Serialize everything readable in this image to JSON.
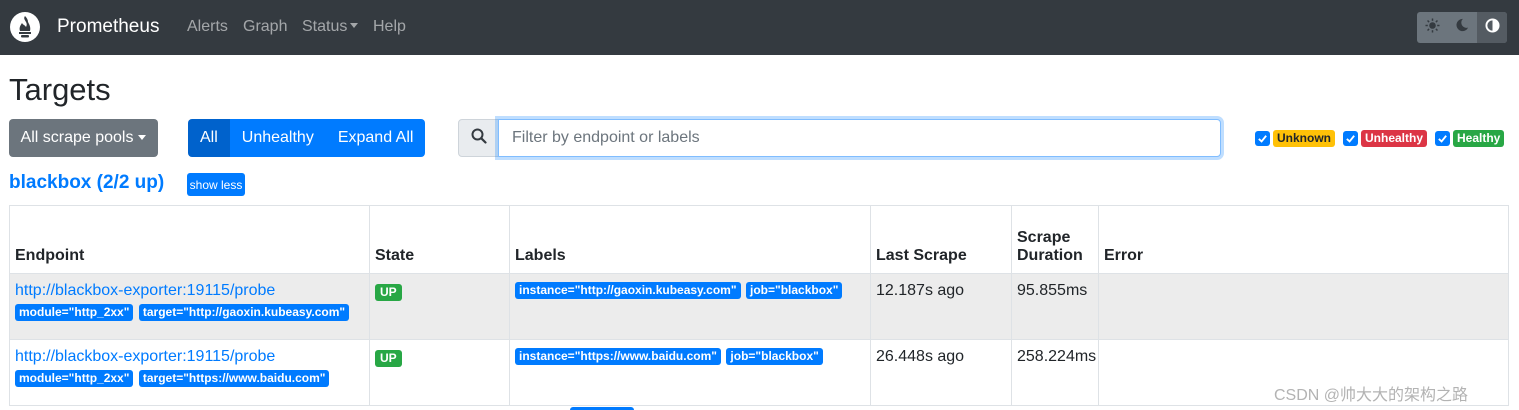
{
  "navbar": {
    "brand": "Prometheus",
    "links": [
      "Alerts",
      "Graph",
      "Status",
      "Help"
    ]
  },
  "page": {
    "title": "Targets"
  },
  "controls": {
    "scrape_pools_label": "All scrape pools",
    "filter_buttons": [
      "All",
      "Unhealthy",
      "Expand All"
    ],
    "search_placeholder": "Filter by endpoint or labels",
    "legend": [
      "Unknown",
      "Unhealthy",
      "Healthy"
    ]
  },
  "pool": {
    "title": "blackbox (2/2 up)",
    "toggle_label": "show less",
    "columns": [
      "Endpoint",
      "State",
      "Labels",
      "Last Scrape",
      "Scrape Duration",
      "Error"
    ],
    "rows": [
      {
        "endpoint": "http://blackbox-exporter:19115/probe",
        "endpoint_params": [
          "module=\"http_2xx\"",
          "target=\"http://gaoxin.kubeasy.com\""
        ],
        "state": "UP",
        "labels": [
          "instance=\"http://gaoxin.kubeasy.com\"",
          "job=\"blackbox\""
        ],
        "last_scrape": "12.187s ago",
        "scrape_duration": "95.855ms",
        "error": ""
      },
      {
        "endpoint": "http://blackbox-exporter:19115/probe",
        "endpoint_params": [
          "module=\"http_2xx\"",
          "target=\"https://www.baidu.com\""
        ],
        "state": "UP",
        "labels": [
          "instance=\"https://www.baidu.com\"",
          "job=\"blackbox\""
        ],
        "last_scrape": "26.448s ago",
        "scrape_duration": "258.224ms",
        "error": ""
      }
    ]
  },
  "watermark": "CSDN @帅大大的架构之路",
  "colors": {
    "navbar": "#343a40",
    "primary": "#007bff",
    "secondary": "#6c757d",
    "warning": "#ffc107",
    "danger": "#dc3545",
    "success": "#28a745"
  }
}
